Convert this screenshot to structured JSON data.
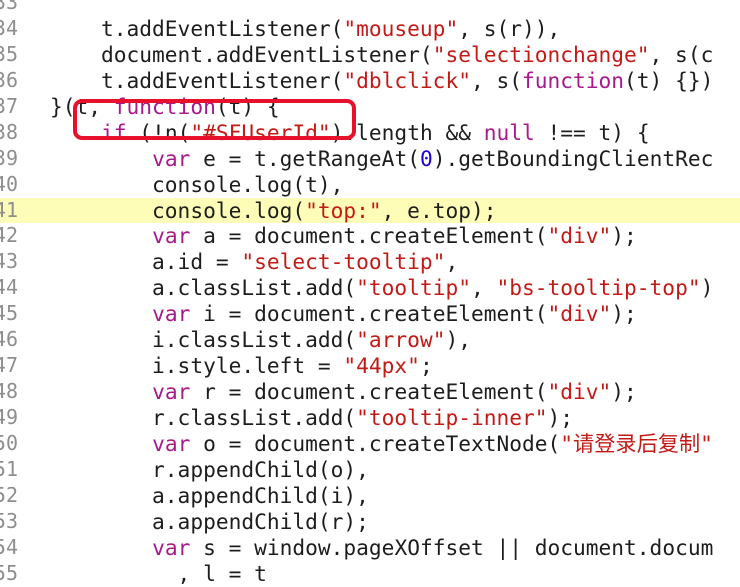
{
  "code_lines": [
    {
      "num": "33",
      "text": ""
    },
    {
      "num": "34",
      "text": "    t.addEventListener(\"mouseup\", s(r)),"
    },
    {
      "num": "35",
      "text": "    document.addEventListener(\"selectionchange\", s(c"
    },
    {
      "num": "36",
      "text": "    t.addEventListener(\"dblclick\", s(function(t) {})"
    },
    {
      "num": "37",
      "text": "}(t, function(t) {"
    },
    {
      "num": "38",
      "text": "    if (!n(\"#SFUserId\").length && null !== t) {"
    },
    {
      "num": "39",
      "text": "        var e = t.getRangeAt(0).getBoundingClientRec"
    },
    {
      "num": "40",
      "text": "        console.log(t),"
    },
    {
      "num": "41",
      "text": "        console.log(\"top:\", e.top);"
    },
    {
      "num": "42",
      "text": "        var a = document.createElement(\"div\");"
    },
    {
      "num": "43",
      "text": "        a.id = \"select-tooltip\","
    },
    {
      "num": "44",
      "text": "        a.classList.add(\"tooltip\", \"bs-tooltip-top\")"
    },
    {
      "num": "45",
      "text": "        var i = document.createElement(\"div\");"
    },
    {
      "num": "46",
      "text": "        i.classList.add(\"arrow\"),"
    },
    {
      "num": "47",
      "text": "        i.style.left = \"44px\";"
    },
    {
      "num": "48",
      "text": "        var r = document.createElement(\"div\");"
    },
    {
      "num": "49",
      "text": "        r.classList.add(\"tooltip-inner\");"
    },
    {
      "num": "50",
      "text": "        var o = document.createTextNode(\"请登录后复制\""
    },
    {
      "num": "51",
      "text": "        r.appendChild(o),"
    },
    {
      "num": "52",
      "text": "        a.appendChild(i),"
    },
    {
      "num": "53",
      "text": "        a.appendChild(r);"
    },
    {
      "num": "54",
      "text": "        var s = window.pageXOffset || document.docum"
    },
    {
      "num": "55",
      "text": "          , l = t"
    }
  ],
  "highlighted_line": "41",
  "annotation": {
    "target": "!n(\"#SFUserId\")",
    "color": "#e8112d"
  },
  "colors": {
    "keyword": "#a8198c",
    "string": "#c41a16",
    "number": "#1c00cf",
    "highlight": "#fdfdb8"
  }
}
